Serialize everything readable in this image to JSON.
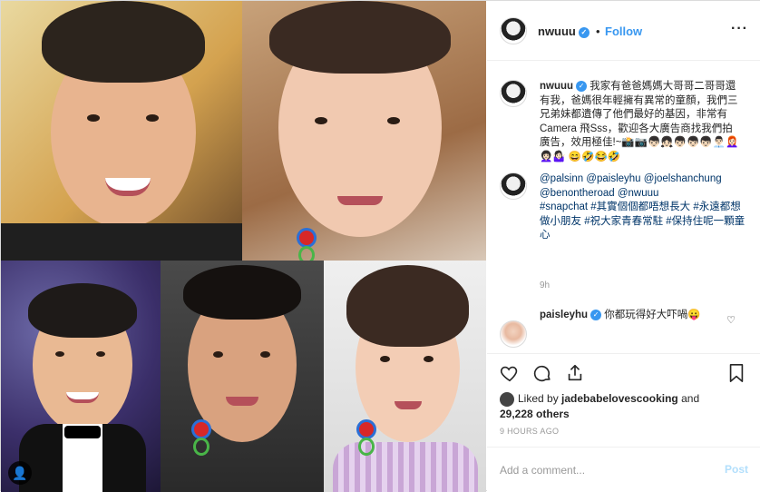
{
  "header": {
    "username": "nwuuu",
    "separator": "•",
    "follow_label": "Follow",
    "more_label": "···"
  },
  "caption": {
    "username": "nwuuu",
    "text": "我家有爸爸媽媽大哥哥二哥哥還有我，爸媽很年輕擁有異常的童顏，我們三兄弟妹都遺傳了他們最好的基因，非常有Camera 飛Sss，歡迎各大廣告商找我們拍廣告，效用極佳!~📸📷👦🏻👧🏻👦🏻👦🏻👦🏻👨🏻‍💼👩🏻‍🦰👩🏻‍🦱🤷🏻‍♀️ 😄🤣😂🤣"
  },
  "comment2": {
    "mentions": "@palsinn @paisleyhu @joelshanchung @benontheroad @nwuuu",
    "hashtags": "#snapchat #其實個個都唔想長大 #永遠都想做小朋友 #祝大家青春常駐 #保持住呢一顆童心"
  },
  "comment_time": "9h",
  "comment3": {
    "username": "paisleyhu",
    "text": "你都玩得好大吓喎😛"
  },
  "likes": {
    "prefix": "Liked by",
    "user": "jadebabelovescooking",
    "and": "and",
    "count": "29,228 others"
  },
  "post_time": "9 HOURS AGO",
  "add_comment": {
    "placeholder": "Add a comment...",
    "post_label": "Post"
  },
  "icons": {
    "like": "heart-icon",
    "comment": "comment-icon",
    "share": "share-icon",
    "save": "bookmark-icon",
    "verified": "verified-badge-icon",
    "tag": "person-tag-icon"
  },
  "colors": {
    "accent": "#3897f0",
    "post_disabled": "#b2dffc",
    "border": "#efefef"
  }
}
